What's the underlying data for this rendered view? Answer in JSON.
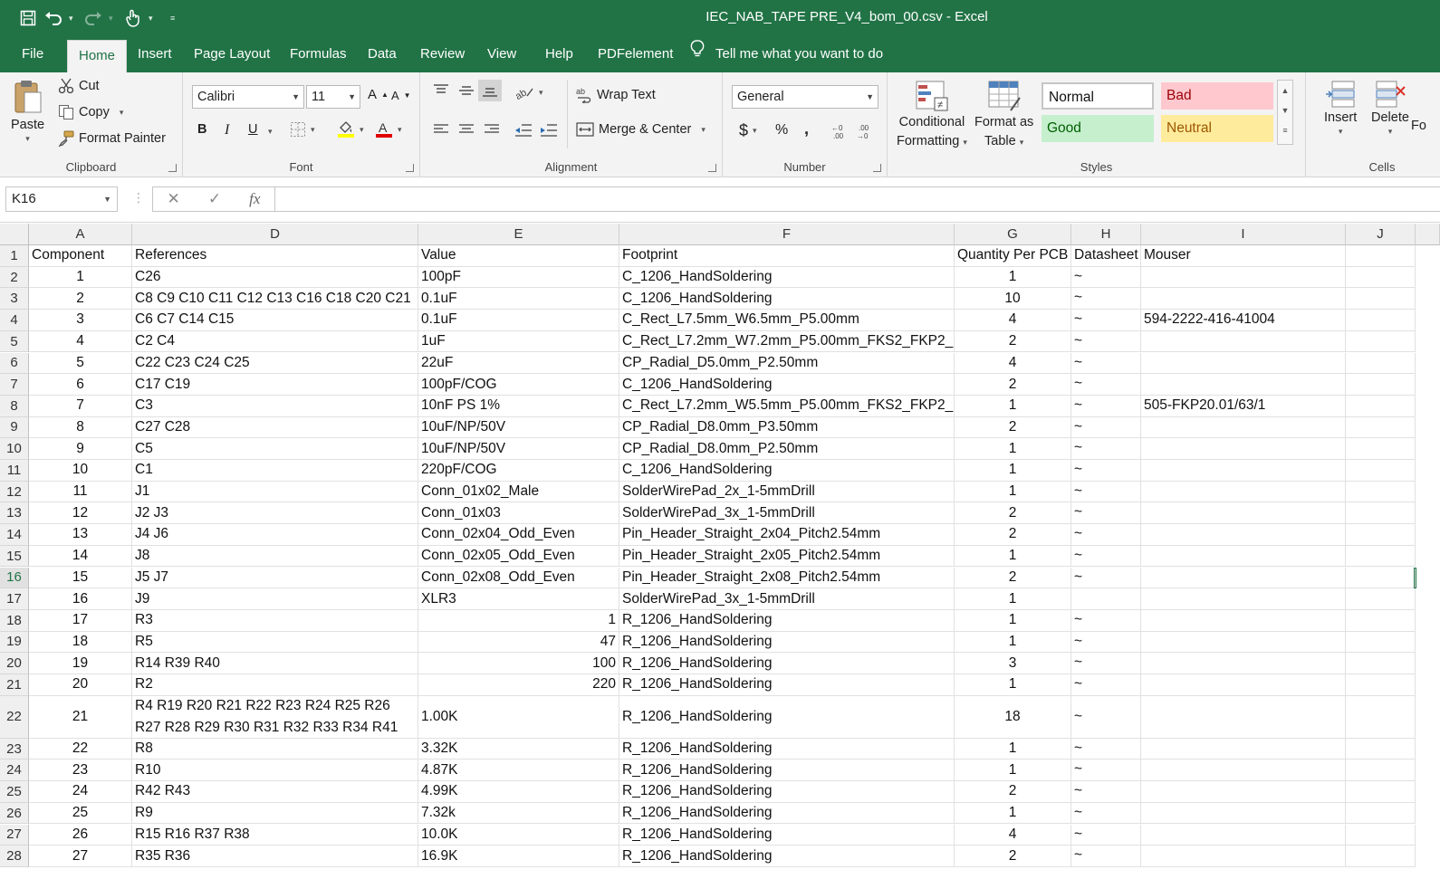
{
  "window": {
    "title": "IEC_NAB_TAPE PRE_V4_bom_00.csv  -  Excel"
  },
  "menu": {
    "tabs": [
      {
        "label": "File"
      },
      {
        "label": "Home"
      },
      {
        "label": "Insert"
      },
      {
        "label": "Page Layout"
      },
      {
        "label": "Formulas"
      },
      {
        "label": "Data"
      },
      {
        "label": "Review"
      },
      {
        "label": "View"
      },
      {
        "label": "Help"
      },
      {
        "label": "PDFelement"
      }
    ],
    "active_tab": "Home",
    "tell_me": "Tell me what you want to do"
  },
  "ribbon": {
    "clipboard": {
      "label": "Clipboard",
      "paste": "Paste",
      "cut": "Cut",
      "copy": "Copy",
      "format_painter": "Format Painter"
    },
    "font": {
      "label": "Font",
      "font_name": "Calibri",
      "font_size": "11",
      "bold": "B",
      "italic": "I",
      "underline": "U",
      "highlight_color": "#ffff00",
      "font_color": "#e00000"
    },
    "alignment": {
      "label": "Alignment",
      "wrap_text": "Wrap Text",
      "merge_center": "Merge & Center"
    },
    "number": {
      "label": "Number",
      "format": "General",
      "currency": "$",
      "percent": "%",
      "comma": ","
    },
    "styles": {
      "label": "Styles",
      "conditional_formatting": [
        "Conditional",
        "Formatting"
      ],
      "format_as_table": [
        "Format as",
        "Table"
      ],
      "normal": "Normal",
      "bad": "Bad",
      "good": "Good",
      "neutral": "Neutral",
      "colors": {
        "bad_bg": "#ffc7ce",
        "bad_fg": "#9c0006",
        "good_bg": "#c6efce",
        "good_fg": "#006100",
        "neutral_bg": "#ffeb9c",
        "neutral_fg": "#9c5700"
      }
    },
    "cells": {
      "label": "Cells",
      "insert": "Insert",
      "delete": "Delete",
      "format_partial": "Fo"
    }
  },
  "formula_bar": {
    "name_box": "K16",
    "fx": "fx",
    "content": ""
  },
  "sheet": {
    "columns": [
      "A",
      "D",
      "E",
      "F",
      "G",
      "H",
      "I",
      "J"
    ],
    "selected_row": 16,
    "header_row": [
      "Component",
      "References",
      "Value",
      "Footprint",
      "Quantity Per PCB",
      "Datasheet",
      "Mouser",
      ""
    ],
    "rows": [
      {
        "n": "2",
        "a": "1",
        "d": "C26",
        "e": "100pF",
        "f": "C_1206_HandSoldering",
        "g": "1",
        "h": "~",
        "i": ""
      },
      {
        "n": "3",
        "a": "2",
        "d": "C8 C9 C10 C11 C12 C13 C16 C18 C20 C21",
        "e": "0.1uF",
        "f": "C_1206_HandSoldering",
        "g": "10",
        "h": "~",
        "i": ""
      },
      {
        "n": "4",
        "a": "3",
        "d": "C6 C7 C14 C15",
        "e": "0.1uF",
        "f": "C_Rect_L7.5mm_W6.5mm_P5.00mm",
        "g": "4",
        "h": "~",
        "i": "594-2222-416-41004"
      },
      {
        "n": "5",
        "a": "4",
        "d": "C2 C4",
        "e": "1uF",
        "f": "C_Rect_L7.2mm_W7.2mm_P5.00mm_FKS2_FKP2_",
        "g": "2",
        "h": "~",
        "i": ""
      },
      {
        "n": "6",
        "a": "5",
        "d": "C22 C23 C24 C25",
        "e": "22uF",
        "f": "CP_Radial_D5.0mm_P2.50mm",
        "g": "4",
        "h": "~",
        "i": ""
      },
      {
        "n": "7",
        "a": "6",
        "d": "C17 C19",
        "e": "100pF/COG",
        "f": "C_1206_HandSoldering",
        "g": "2",
        "h": "~",
        "i": ""
      },
      {
        "n": "8",
        "a": "7",
        "d": "C3",
        "e": "10nF PS 1%",
        "f": "C_Rect_L7.2mm_W5.5mm_P5.00mm_FKS2_FKP2_",
        "g": "1",
        "h": "~",
        "i": "505-FKP20.01/63/1"
      },
      {
        "n": "9",
        "a": "8",
        "d": "C27 C28",
        "e": "10uF/NP/50V",
        "f": "CP_Radial_D8.0mm_P3.50mm",
        "g": "2",
        "h": "~",
        "i": ""
      },
      {
        "n": "10",
        "a": "9",
        "d": "C5",
        "e": "10uF/NP/50V",
        "f": "CP_Radial_D8.0mm_P2.50mm",
        "g": "1",
        "h": "~",
        "i": ""
      },
      {
        "n": "11",
        "a": "10",
        "d": "C1",
        "e": "220pF/COG",
        "f": "C_1206_HandSoldering",
        "g": "1",
        "h": "~",
        "i": ""
      },
      {
        "n": "12",
        "a": "11",
        "d": "J1",
        "e": "Conn_01x02_Male",
        "f": "SolderWirePad_2x_1-5mmDrill",
        "g": "1",
        "h": "~",
        "i": ""
      },
      {
        "n": "13",
        "a": "12",
        "d": "J2 J3",
        "e": "Conn_01x03",
        "f": "SolderWirePad_3x_1-5mmDrill",
        "g": "2",
        "h": "~",
        "i": ""
      },
      {
        "n": "14",
        "a": "13",
        "d": "J4 J6",
        "e": "Conn_02x04_Odd_Even",
        "f": "Pin_Header_Straight_2x04_Pitch2.54mm",
        "g": "2",
        "h": "~",
        "i": ""
      },
      {
        "n": "15",
        "a": "14",
        "d": "J8",
        "e": "Conn_02x05_Odd_Even",
        "f": "Pin_Header_Straight_2x05_Pitch2.54mm",
        "g": "1",
        "h": "~",
        "i": ""
      },
      {
        "n": "16",
        "a": "15",
        "d": "J5 J7",
        "e": "Conn_02x08_Odd_Even",
        "f": "Pin_Header_Straight_2x08_Pitch2.54mm",
        "g": "2",
        "h": "~",
        "i": ""
      },
      {
        "n": "17",
        "a": "16",
        "d": "J9",
        "e": "XLR3",
        "f": "SolderWirePad_3x_1-5mmDrill",
        "g": "1",
        "h": "",
        "i": ""
      },
      {
        "n": "18",
        "a": "17",
        "d": "R3",
        "e": "1",
        "e_num": true,
        "f": "R_1206_HandSoldering",
        "g": "1",
        "h": "~",
        "i": ""
      },
      {
        "n": "19",
        "a": "18",
        "d": "R5",
        "e": "47",
        "e_num": true,
        "f": "R_1206_HandSoldering",
        "g": "1",
        "h": "~",
        "i": ""
      },
      {
        "n": "20",
        "a": "19",
        "d": "R14 R39 R40",
        "e": "100",
        "e_num": true,
        "f": "R_1206_HandSoldering",
        "g": "3",
        "h": "~",
        "i": ""
      },
      {
        "n": "21",
        "a": "20",
        "d": "R2",
        "e": "220",
        "e_num": true,
        "f": "R_1206_HandSoldering",
        "g": "1",
        "h": "~",
        "i": ""
      },
      {
        "n": "22",
        "a": "21",
        "d": "R4 R19 R20 R21 R22 R23 R24 R25 R26 R27 R28 R29 R30 R31 R32 R33 R34 R41",
        "e": "1.00K",
        "f": "R_1206_HandSoldering",
        "g": "18",
        "h": "~",
        "i": "",
        "tall": true
      },
      {
        "n": "23",
        "a": "22",
        "d": "R8",
        "e": "3.32K",
        "f": "R_1206_HandSoldering",
        "g": "1",
        "h": "~",
        "i": ""
      },
      {
        "n": "24",
        "a": "23",
        "d": "R10",
        "e": "4.87K",
        "f": "R_1206_HandSoldering",
        "g": "1",
        "h": "~",
        "i": ""
      },
      {
        "n": "25",
        "a": "24",
        "d": "R42 R43",
        "e": "4.99K",
        "f": "R_1206_HandSoldering",
        "g": "2",
        "h": "~",
        "i": ""
      },
      {
        "n": "26",
        "a": "25",
        "d": "R9",
        "e": "7.32k",
        "f": "R_1206_HandSoldering",
        "g": "1",
        "h": "~",
        "i": ""
      },
      {
        "n": "27",
        "a": "26",
        "d": "R15 R16 R37 R38",
        "e": "10.0K",
        "f": "R_1206_HandSoldering",
        "g": "4",
        "h": "~",
        "i": ""
      },
      {
        "n": "28",
        "a": "27",
        "d": "R35 R36",
        "e": "16.9K",
        "f": "R_1206_HandSoldering",
        "g": "2",
        "h": "~",
        "i": ""
      }
    ]
  }
}
